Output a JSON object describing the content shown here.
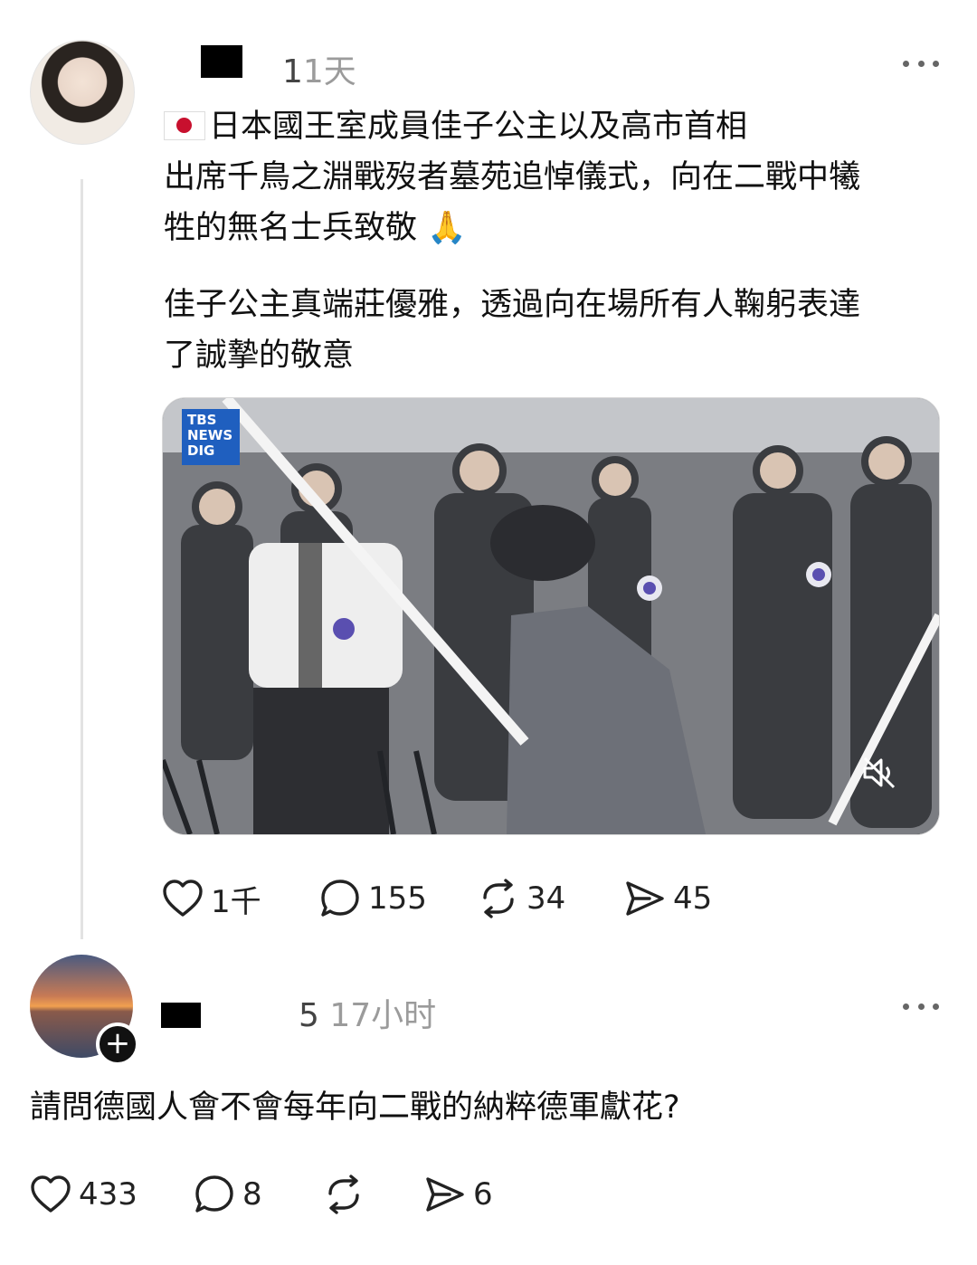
{
  "post": {
    "time": "1天",
    "time_prefix": "1",
    "text_line1": "日本國王室成員佳子公主以及高市首相",
    "text_line2": "出席千鳥之淵戰歿者墓苑追悼儀式，向在二戰中犧",
    "text_line3": "牲的無名士兵致敬 🙏",
    "text_line4": "佳子公主真端莊優雅，透過向在場所有人鞠躬表達",
    "text_line5": "了誠摯的敬意",
    "media": {
      "logo_text": "TBS\nNEWS\nDIG"
    },
    "actions": {
      "likes": "1千",
      "comments": "155",
      "reposts": "34",
      "shares": "45"
    }
  },
  "reply": {
    "time_prefix": "5",
    "time": "17小时",
    "text": "請問德國人會不會每年向二戰的納粹德軍獻花?",
    "follow_symbol": "+",
    "actions": {
      "likes": "433",
      "comments": "8",
      "reposts": "",
      "shares": "6"
    }
  },
  "icons": {
    "more": "more-horizontal-icon",
    "like": "heart-icon",
    "comment": "comment-bubble-icon",
    "repost": "repost-icon",
    "share": "send-icon",
    "mute": "mute-icon"
  },
  "colors": {
    "text": "#111111",
    "muted": "#9b9b9b",
    "flag_red": "#c8102e",
    "logo_blue": "#1f5fbf"
  }
}
